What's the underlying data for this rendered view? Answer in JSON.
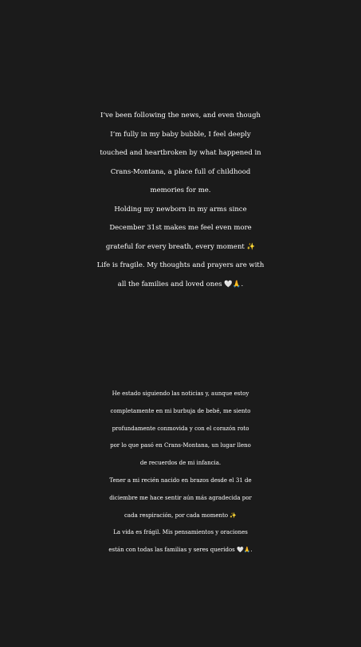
{
  "story": {
    "background_color": "#1b1b1b",
    "text_color": "#ffffff",
    "english_lines": [
      "I’ve been following the news, and even though",
      "I’m fully in my baby bubble, I feel deeply",
      "touched and heartbroken by what happened in",
      "Crans-Montana, a place full of childhood",
      "memories for me.",
      "Holding my newborn in my arms since",
      "December 31st makes me feel even more",
      "grateful for every breath, every moment ✨",
      "Life is fragile. My thoughts and prayers are with",
      "all the families and loved ones 🤍🙏."
    ],
    "spanish_lines": [
      "He estado siguiendo las noticias y, aunque estoy",
      "completamente en mi burbuja de bebé, me siento",
      "profundamente conmovida y con el corazón roto",
      "por lo que pasó en Crans-Montana, un lugar lleno",
      "de recuerdos de mi infancia.",
      "Tener a mi recién nacido en brazos desde el 31 de",
      "diciembre me hace sentir aún más agradecida por",
      "cada respiración, por cada momento ✨",
      "La vida es frágil. Mis pensamientos y oraciones",
      "están con todas las familias y seres queridos 🤍🙏."
    ]
  }
}
